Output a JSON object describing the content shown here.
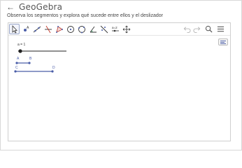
{
  "header": {
    "back_icon": "arrow-left-icon",
    "logo_text": "GeoGebra"
  },
  "instruction": "Observa los segmentos y explora qué sucede entre ellos y el deslizador",
  "toolbar": {
    "tools": [
      {
        "name": "move-tool",
        "icon": "cursor-icon",
        "selected": true
      },
      {
        "name": "point-tool",
        "icon": "point-icon"
      },
      {
        "name": "line-tool",
        "icon": "line-icon"
      },
      {
        "name": "perpendicular-line-tool",
        "icon": "perpendicular-icon"
      },
      {
        "name": "polygon-tool",
        "icon": "polygon-icon"
      },
      {
        "name": "circle-tool",
        "icon": "circle-center-icon"
      },
      {
        "name": "circle-three-points-tool",
        "icon": "circle-points-icon"
      },
      {
        "name": "angle-tool",
        "icon": "angle-icon"
      },
      {
        "name": "reflect-tool",
        "icon": "reflect-icon"
      },
      {
        "name": "slider-tool",
        "icon": "slider-icon"
      },
      {
        "name": "move-graphics-tool",
        "icon": "move-graphics-icon"
      }
    ],
    "right": [
      "undo-icon",
      "redo-icon",
      "search-icon",
      "menu-icon"
    ]
  },
  "graphics": {
    "slider": {
      "label": "a = 1",
      "value": 1
    },
    "segment_ab": {
      "label_a": "A",
      "label_b": "B"
    },
    "segment_cd": {
      "label_c": "C",
      "label_d": "D"
    },
    "style_bar_icon": "style-bar-icon"
  },
  "colors": {
    "point": "#4a5da8",
    "slider": "#222222",
    "segment": "#4a5da8",
    "label_point": "#4a5da8"
  }
}
